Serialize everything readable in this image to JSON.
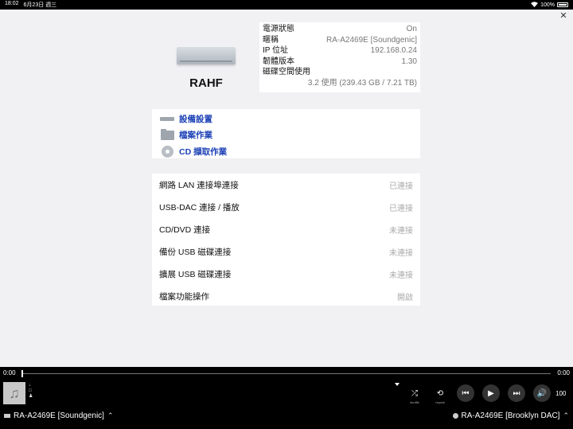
{
  "status_bar": {
    "time": "18:02",
    "date": "6月23日 週三",
    "battery": "100%"
  },
  "device": {
    "name": "RAHF"
  },
  "info": {
    "rows": [
      {
        "label": "電源狀態",
        "value": "On"
      },
      {
        "label": "暱稱",
        "value": "RA-A2469E [Soundgenic]"
      },
      {
        "label": "IP 位址",
        "value": "192.168.0.24"
      },
      {
        "label": "韌體版本",
        "value": "1.30"
      }
    ],
    "disk_label": "磁碟空間使用",
    "disk_value": "3.2 使用 (239.43 GB / 7.21 TB)"
  },
  "menu": {
    "items": [
      {
        "label": "設備設置",
        "icon": "device-icon"
      },
      {
        "label": "檔案作業",
        "icon": "folder-icon"
      },
      {
        "label": "CD 擷取作業",
        "icon": "cd-icon"
      }
    ]
  },
  "connections": [
    {
      "label": "網路 LAN 連接埠連接",
      "status": "已連接"
    },
    {
      "label": "USB-DAC 連接 / 播放",
      "status": "已連接"
    },
    {
      "label": "CD/DVD 連接",
      "status": "未連接"
    },
    {
      "label": "備份 USB 磁碟連接",
      "status": "未連接"
    },
    {
      "label": "擴展 USB 磁碟連接",
      "status": "未連接"
    },
    {
      "label": "檔案功能操作",
      "status": "開啟"
    }
  ],
  "player": {
    "time_elapsed": "0:00",
    "time_total": "0:00",
    "shuffle_label": "shuffle",
    "repeat_label": "repeat",
    "volume": "100",
    "source": "RA-A2469E [Soundgenic]",
    "destination": "RA-A2469E [Brooklyn DAC]"
  }
}
